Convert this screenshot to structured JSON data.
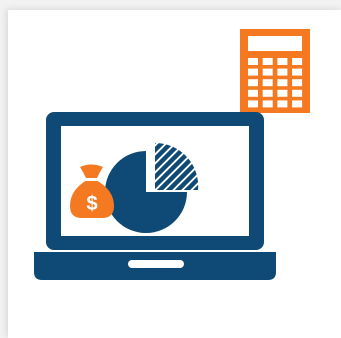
{
  "illustration": {
    "icons": [
      "calculator-icon",
      "laptop-icon",
      "pie-chart-icon",
      "money-bag-icon"
    ],
    "money_bag_symbol": "$"
  },
  "colors": {
    "laptop": "#0e4a75",
    "accent_orange": "#f47920",
    "background": "#f2f2f2",
    "card": "#ffffff",
    "screen": "#ffffff"
  }
}
